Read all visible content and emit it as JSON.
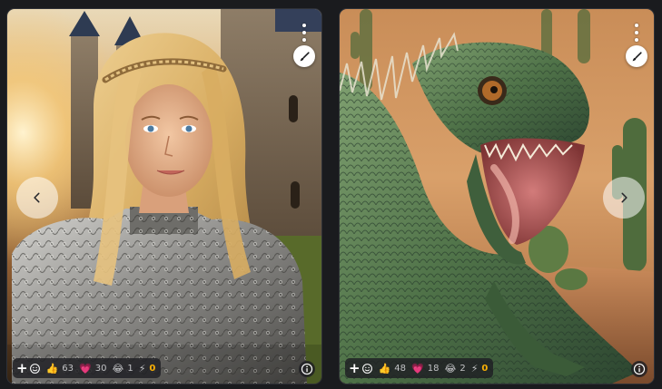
{
  "cards": [
    {
      "subject": "blonde woman in ornate silver armor before a castle",
      "nav": "previous",
      "reactions": {
        "like": {
          "icon": "thumbs-up-icon",
          "glyph": "👍",
          "count": "63"
        },
        "heart": {
          "icon": "heart-icon",
          "glyph": "💗",
          "count": "30"
        },
        "laugh": {
          "icon": "laugh-icon",
          "glyph": "😂",
          "count": "1"
        },
        "buzz": {
          "icon": "lightning-icon",
          "glyph": "⚡",
          "count": "0"
        }
      }
    },
    {
      "subject": "spiky green lizard roaring in a desert",
      "nav": "next",
      "reactions": {
        "like": {
          "icon": "thumbs-up-icon",
          "glyph": "👍",
          "count": "48"
        },
        "heart": {
          "icon": "heart-icon",
          "glyph": "💗",
          "count": "18"
        },
        "laugh": {
          "icon": "laugh-icon",
          "glyph": "😂",
          "count": "2"
        },
        "buzz": {
          "icon": "lightning-icon",
          "glyph": "⚡",
          "count": "0"
        }
      }
    }
  ],
  "colors": {
    "page_bg": "#1a1b1e",
    "buzz": "#fab005",
    "count_text": "#c1c2c5"
  }
}
